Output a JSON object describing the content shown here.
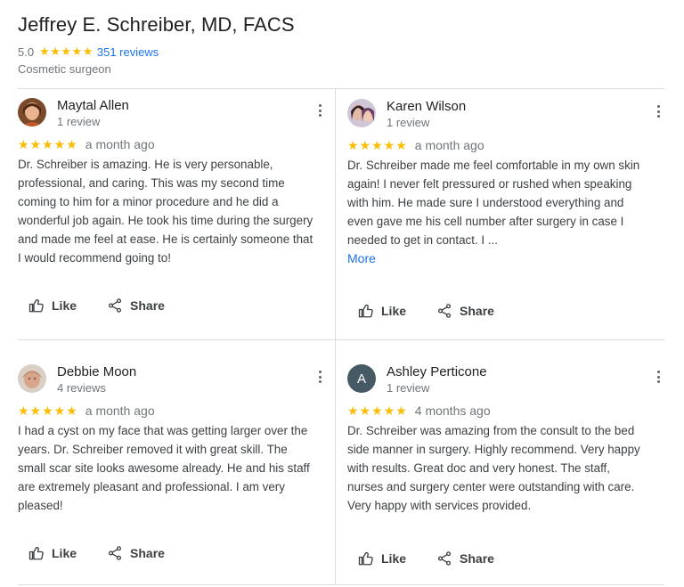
{
  "header": {
    "name": "Jeffrey E. Schreiber, MD, FACS",
    "rating": "5.0",
    "stars": "★★★★★",
    "reviews_link": "351 reviews",
    "specialty": "Cosmetic surgeon"
  },
  "colors": {
    "star": "#fbbc04",
    "link": "#1a73e8",
    "divider": "#dadce0"
  },
  "reviews": [
    {
      "name": "Maytal Allen",
      "count": "1 review",
      "stars": "★★★★★",
      "time": "a month ago",
      "lines": [
        "Dr. Schreiber is amazing. He is very personable,",
        "professional, and caring. This was my second time",
        "coming to him for a minor procedure and he did a",
        "wonderful job again. He took his time during the surgery",
        "and made me feel at ease. He is certainly someone that",
        "I would recommend going to!"
      ],
      "like": "Like",
      "share": "Share"
    },
    {
      "name": "Karen Wilson",
      "count": "1 review",
      "stars": "★★★★★",
      "time": "a month ago",
      "lines": [
        "Dr. Schreiber made me feel comfortable in my own skin",
        "again! I never felt pressured or rushed when speaking",
        "with him. He made sure I understood everything and",
        "even gave me his cell number after surgery in case I",
        "needed to get in contact. I ..."
      ],
      "more": "More",
      "like": "Like",
      "share": "Share"
    },
    {
      "name": "Debbie Moon",
      "count": "4 reviews",
      "stars": "★★★★★",
      "time": "a month ago",
      "lines": [
        "I had a cyst on my face that was getting larger over the",
        "years. Dr. Schreiber removed it with great skill. The",
        "small scar site looks awesome already. He and his staff",
        "are extremely pleasant and professional. I am very",
        "pleased!"
      ],
      "like": "Like",
      "share": "Share"
    },
    {
      "name": "Ashley Perticone",
      "count": "1 review",
      "initial": "A",
      "stars": "★★★★★",
      "time": "4 months ago",
      "lines": [
        "Dr. Schreiber was amazing from the consult to the bed",
        "side manner in surgery. Highly recommend. Very happy",
        "with results. Great doc and very honest. The staff,",
        "nurses and surgery center were outstanding with care.",
        "Very happy with services provided."
      ],
      "like": "Like",
      "share": "Share"
    }
  ]
}
